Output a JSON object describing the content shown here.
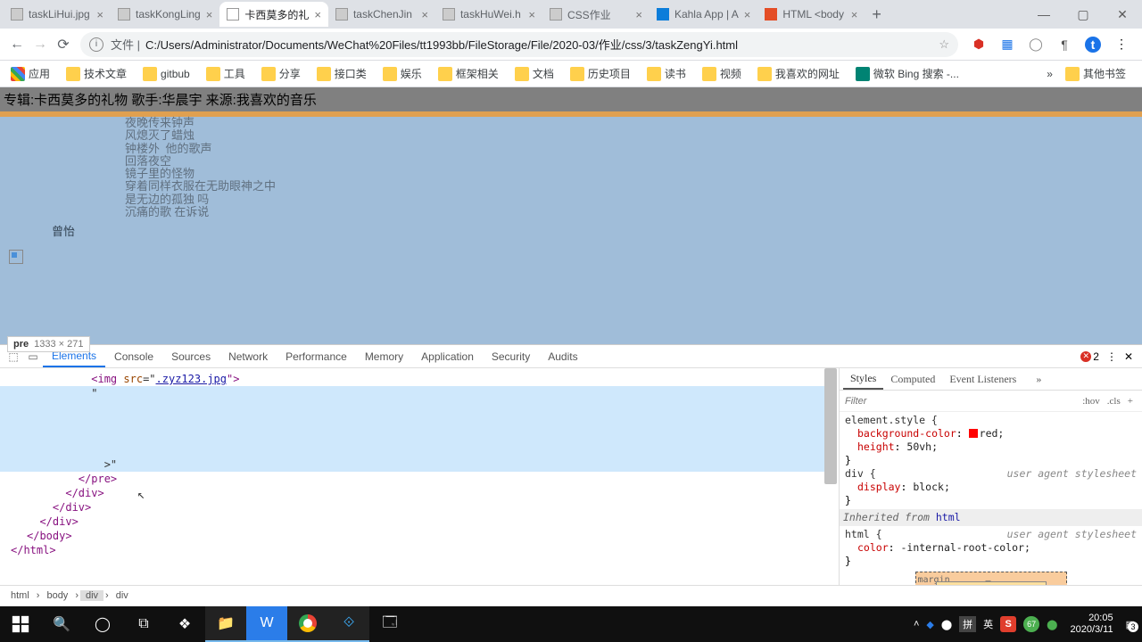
{
  "tabs": [
    {
      "title": "taskLiHui.jpg",
      "fav": "#808080"
    },
    {
      "title": "taskKongLing",
      "fav": "#808080"
    },
    {
      "title": "卡西莫多的礼",
      "fav": "#808080",
      "active": true
    },
    {
      "title": "taskChenJin",
      "fav": "#808080"
    },
    {
      "title": "taskHuWei.h",
      "fav": "#808080"
    },
    {
      "title": "CSS作业",
      "fav": "#808080"
    },
    {
      "title": "Kahla App | A",
      "fav": "#0b7dda"
    },
    {
      "title": "HTML <body",
      "fav": "#e44d26"
    }
  ],
  "address": {
    "prefix": "文件 |",
    "url": "C:/Users/Administrator/Documents/WeChat%20Files/tt1993bb/FileStorage/File/2020-03/作业/css/3/taskZengYi.html"
  },
  "bookmarks": [
    "应用",
    "技术文章",
    "gitbub",
    "工具",
    "分享",
    "接口类",
    "娱乐",
    "框架相关",
    "文档",
    "历史项目",
    "读书",
    "视频",
    "我喜欢的网址",
    "微软 Bing 搜索 -..."
  ],
  "bookmarks_right": "其他书签",
  "page": {
    "header": "专辑:卡西莫多的礼物 歌手:华晨宇 来源:我喜欢的音乐",
    "lyrics": "夜晚传来钟声\n风熄灭了蜡烛\n钟楼外  他的歌声\n回落夜空\n镜子里的怪物\n穿着同样衣服在无助眼神之中\n是无边的孤独 吗\n沉痛的歌 在诉说",
    "author": "曾怡",
    "tooltip_tag": "pre",
    "tooltip_size": "1333 × 271"
  },
  "devtools": {
    "tabs": [
      "Elements",
      "Console",
      "Sources",
      "Network",
      "Performance",
      "Memory",
      "Application",
      "Security",
      "Audits"
    ],
    "active_tab": "Elements",
    "errors": "2",
    "dom": {
      "l1a": "<img ",
      "l1b": "src",
      "l1c": "=\"",
      "l1d": ".zyz123.jpg",
      "l1e": "\">",
      "l2": "\"",
      "l3": ">\"",
      "l4": "</pre>",
      "l5": "</div>",
      "l6": "</div>",
      "l7": "</div>",
      "l8": "</body>",
      "l9": "</html>"
    },
    "crumbs": [
      "html",
      "body",
      "div",
      "div"
    ],
    "styles": {
      "subtabs": [
        "Styles",
        "Computed",
        "Event Listeners"
      ],
      "filter": "Filter",
      "hov": ":hov",
      "cls": ".cls",
      "r1_sel": "element.style {",
      "r1_p1": "background-color",
      "r1_v1": "red;",
      "r1_p2": "height",
      "r1_v2": "50vh;",
      "close": "}",
      "r2_sel": "div {",
      "r2_ua": "user agent stylesheet",
      "r2_p1": "display",
      "r2_v1": "block;",
      "inh": "Inherited from ",
      "inh_link": "html",
      "r3_sel": "html {",
      "r3_ua": "user agent stylesheet",
      "r3_p1": "color",
      "r3_v1": "-internal-root-color;",
      "box_label": "margin",
      "box_dash": "–"
    }
  },
  "taskbar": {
    "tray": {
      "ime1": "拼",
      "ime2": "英",
      "clock_time": "20:05",
      "clock_date": "2020/3/11",
      "notif": "3"
    }
  }
}
